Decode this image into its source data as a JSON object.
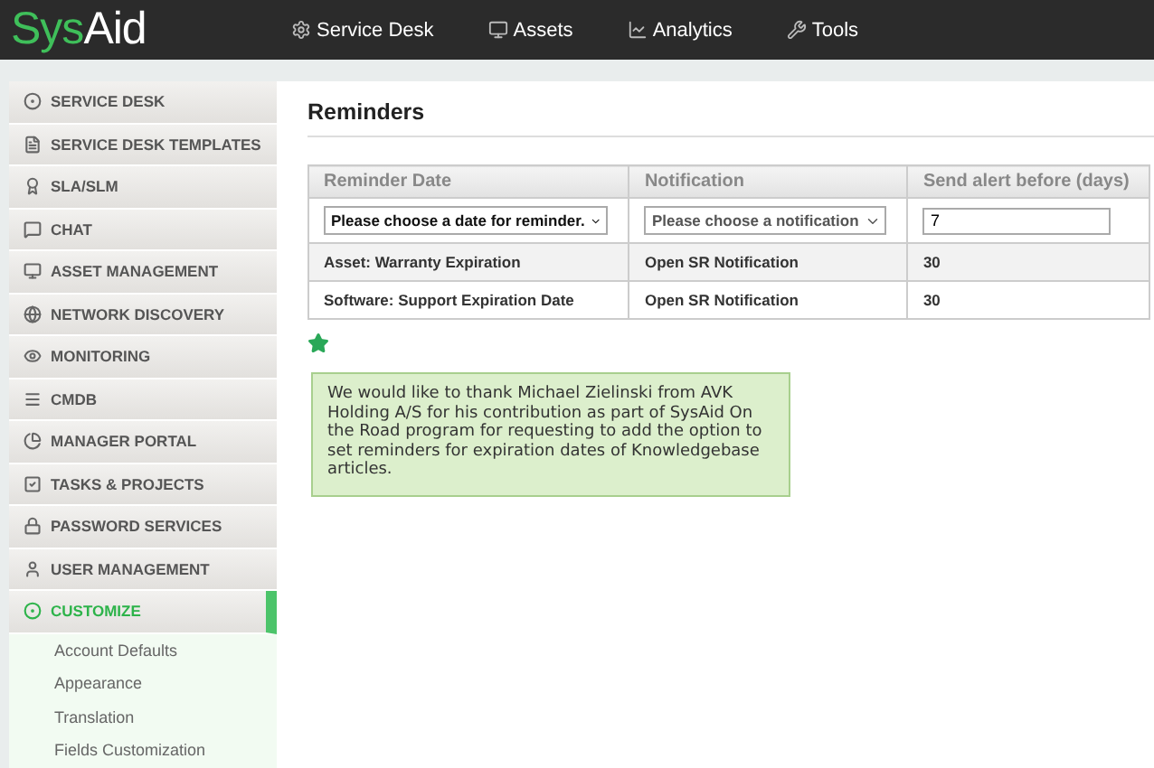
{
  "logo": {
    "part_1": "Sys",
    "part_2": "Aid"
  },
  "top_nav": [
    {
      "label": "Service Desk"
    },
    {
      "label": "Assets"
    },
    {
      "label": "Analytics"
    },
    {
      "label": "Tools"
    }
  ],
  "sidebar": {
    "items": [
      {
        "label": "SERVICE DESK",
        "selected": false
      },
      {
        "label": "SERVICE DESK TEMPLATES",
        "selected": false
      },
      {
        "label": "SLA/SLM",
        "selected": false
      },
      {
        "label": "CHAT",
        "selected": false
      },
      {
        "label": "ASSET MANAGEMENT",
        "selected": false
      },
      {
        "label": "NETWORK DISCOVERY",
        "selected": false
      },
      {
        "label": "MONITORING",
        "selected": false
      },
      {
        "label": "CMDB",
        "selected": false
      },
      {
        "label": "MANAGER PORTAL",
        "selected": false
      },
      {
        "label": "TASKS & PROJECTS",
        "selected": false
      },
      {
        "label": "PASSWORD SERVICES",
        "selected": false
      },
      {
        "label": "USER MANAGEMENT",
        "selected": false
      },
      {
        "label": "CUSTOMIZE",
        "selected": true,
        "children": [
          {
            "label": "Account Defaults"
          },
          {
            "label": "Appearance"
          },
          {
            "label": "Translation"
          },
          {
            "label": "Fields Customization"
          }
        ]
      }
    ]
  },
  "page": {
    "title": "Reminders",
    "table": {
      "columns": [
        "Reminder Date",
        "Notification",
        "Send alert before (days)"
      ],
      "new_row": {
        "date_select": "Please choose a date for reminder.",
        "notification_select": "Please choose a notification",
        "days_field": "7"
      },
      "rows": [
        [
          "Asset: Warranty Expiration",
          "Open SR Notification",
          "30"
        ],
        [
          "Software: Support Expiration Date",
          "Open SR Notification",
          "30"
        ]
      ]
    },
    "note": "We would like to thank Michael Zielinski from AVK Holding A/S for his contribution as part of SysAid On the Road program for requesting to add the option to set reminders for expiration dates of Knowledgebase articles."
  }
}
